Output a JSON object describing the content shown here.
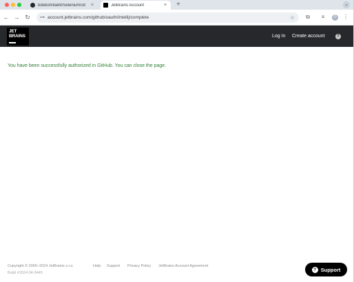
{
  "browser": {
    "tabs": [
      {
        "title": "bdebomita89/SeleniumGit",
        "icon": "github-icon",
        "close": "×"
      },
      {
        "title": "JetBrains Account",
        "icon": "jetbrains-icon",
        "close": "×"
      }
    ],
    "new_tab": "+",
    "tab_menu": "⌄",
    "nav": {
      "back": "←",
      "forward": "→",
      "reload": "↻"
    },
    "site_info_glyph": "⊶",
    "url": "account.jetbrains.com/github/oauth/intellij/complete",
    "bookmark_glyph": "☆",
    "extensions_glyph": "⧉",
    "media_glyph": "≡",
    "profile_initial": "G",
    "menu_glyph": "⋮"
  },
  "header": {
    "logo_text": "JET\nBRAINS",
    "login": "Log In",
    "create_account": "Create account",
    "help_glyph": "?"
  },
  "main": {
    "message": "You have been successfully authorized in GitHub. You can close the page."
  },
  "footer": {
    "copyright": "Copyright © 2000–2024 JetBrains s.r.o.",
    "links": [
      "Help",
      "Support",
      "Privacy Policy",
      "JetBrains Account Agreement"
    ],
    "build": "Build #2024.04-3445"
  },
  "support_button": {
    "label": "Support",
    "icon_glyph": "?"
  },
  "colors": {
    "header_bg": "#27282c",
    "success_text": "#2e7d32",
    "support_bg": "#000000"
  }
}
